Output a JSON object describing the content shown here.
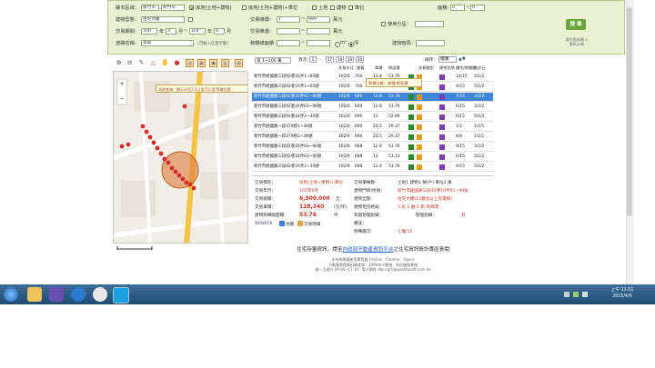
{
  "search": {
    "county_label": "縣市區域：",
    "county_value": "新竹市",
    "district_value": "新竹市",
    "type_options": [
      "房地(土地+建物)",
      "房地(土地+建物)+車位",
      "土地",
      "建物",
      "車位"
    ],
    "building_type_label": "建物型態：",
    "building_type_value": "住宅大樓",
    "total_price_label": "交易總價：",
    "total_price_from": "1",
    "total_price_to": "999",
    "total_price_unit": "萬元",
    "use_zone_label": "使用分區：",
    "date_label": "交易期間：",
    "date_from_year": "100",
    "date_from_month": "3",
    "date_to_year": "104",
    "date_to_month": "4",
    "year_unit": "年",
    "month_unit": "月",
    "unit_price_label": "交易單價：",
    "unit_price_unit": "萬元",
    "area_label": "面積：",
    "area_from": "0",
    "area_to": "0",
    "road_label": "道路名稱：",
    "road_value": "高翠",
    "road_hint": "(可輸入任意字數)",
    "building_area_label": "移轉總面積：",
    "unit_options": [
      "m²",
      "坪"
    ],
    "building_age_label": "建物格局：",
    "search_button": "搜 尋",
    "reset_button": "清除重新輸入 重新計算"
  },
  "table": {
    "paging_value": "第 1~200 筆",
    "page_label": "頁次：",
    "pages": [
      "1",
      "...",
      "17",
      "18",
      "19",
      "20"
    ],
    "sort_label": "排序：",
    "sort_value": "總價",
    "headers": [
      "交易年月",
      "路寬",
      "單價",
      "總面積",
      "交易類型",
      "建物型態",
      "樓別/總樓層",
      "成交日"
    ],
    "tooltip_text": "單價計算：總價/總面積",
    "rows": [
      {
        "addr": "新竹市經國路三段92巷16弄1~60號",
        "date": "102/6",
        "w": "700",
        "price": "12.8",
        "area": "53.76",
        "age": "14/15",
        "day": "3/2/2",
        "sel": false
      },
      {
        "addr": "新竹市經國路三段92巷16弄1~60號",
        "date": "102/6",
        "w": "700",
        "price": "12.8",
        "area": "53.76",
        "age": "9/15",
        "day": "3/2/2",
        "sel": false
      },
      {
        "addr": "新竹市經國路三段92巷16弄61~90號",
        "date": "102/6",
        "w": "690",
        "price": "12.8",
        "area": "53.76",
        "age": "7/15",
        "day": "3/2/2",
        "sel": true
      },
      {
        "addr": "新竹市經國路三段92巷16弄61~90號",
        "date": "102/6",
        "w": "690",
        "price": "12.8",
        "area": "53.76",
        "age": "6/15",
        "day": "3/2/2",
        "sel": false
      },
      {
        "addr": "新竹市經國路三段92巷16弄1~30號",
        "date": "102/6",
        "w": "690",
        "price": "13",
        "area": "52.69",
        "age": "6/15",
        "day": "3/2/2",
        "sel": false
      },
      {
        "addr": "新竹市經國路一段379巷1~30號",
        "date": "102/6",
        "w": "690",
        "price": "23.5",
        "area": "29.37",
        "age": "1/1",
        "day": "1/2/1",
        "sel": false
      },
      {
        "addr": "新竹市經國路一段379巷1~30號",
        "date": "102/6",
        "w": "690",
        "price": "23.5",
        "area": "29.37",
        "age": "8/8",
        "day": "1/2/1",
        "sel": false
      },
      {
        "addr": "新竹市經國路三段92巷16弄61~90號",
        "date": "102/6",
        "w": "688",
        "price": "12.8",
        "area": "53.76",
        "age": "9/15",
        "day": "3/2/2",
        "sel": false
      },
      {
        "addr": "新竹市經國路三段92巷16弄61~90號",
        "date": "102/6",
        "w": "688",
        "price": "13",
        "area": "53.13",
        "age": "6/15",
        "day": "3/2/2",
        "sel": false
      },
      {
        "addr": "新竹市經國路三段92巷16弄1~30號",
        "date": "102/6",
        "w": "688",
        "price": "12.8",
        "area": "53.76",
        "age": "9/15",
        "day": "3/2/2",
        "sel": false
      }
    ]
  },
  "detail": {
    "type_label": "交易標的：",
    "type_value": "房地(土地+建物)+車位",
    "date_label": "交易年月：",
    "date_value": "102年6月",
    "total_label": "交易總價：",
    "total_value": "6,900,000",
    "total_unit": "元",
    "unit_label": "交易單價：",
    "unit_value": "128,340",
    "unit_unit": "(元/坪)",
    "area_label": "建物移轉總面積：",
    "area_value": "53.76",
    "area_unit": "坪",
    "count_text": "193/674",
    "mass_label": "交易筆棟數：",
    "mass_value": "土地1 建物1 棟(戶) 車位2 車",
    "addr_label": "建物門牌/地號：",
    "addr_value": "新竹市經國路三段92巷16弄61~90號",
    "btype_label": "建物型態：",
    "btype_value": "住宅大樓(11層含以上有電梯)",
    "layout_label": "建物現況格局：",
    "layout_value": "3 房 2 廳 2 衛 有隔間",
    "manage_label": "管理組織：",
    "manage_value": "有",
    "use_label": "有無管理組織：",
    "floor_label": "移轉層次：",
    "floor_value": "七層/15",
    "note_label": "備註：",
    "map_link": "地圖",
    "stats_link": "交易明細"
  },
  "map": {
    "tooltip": "周邊查詢：標示半徑2.5公里/5公里/等機位路",
    "paging_label": "第 1~200 筆"
  },
  "footer": {
    "line1_prefix": "住宅存量資訊，請至",
    "line1_link": "內政部不動產資訊平台",
    "line1_suffix": "之住宅資訊統計專區參閱",
    "line2": "本系統建議使用瀏覽器 FireFox、Chrome、Opera",
    "line3": "不動產實價資料庫查詢：1996仲介數據 · 為民服務專線",
    "line4": "週一至週五 09:00~17:30 · 電子郵件 dbp.rgf1@quantasoft.com.tw"
  },
  "taskbar": {
    "time": "上午 11:51",
    "date": "2015/4/6"
  }
}
